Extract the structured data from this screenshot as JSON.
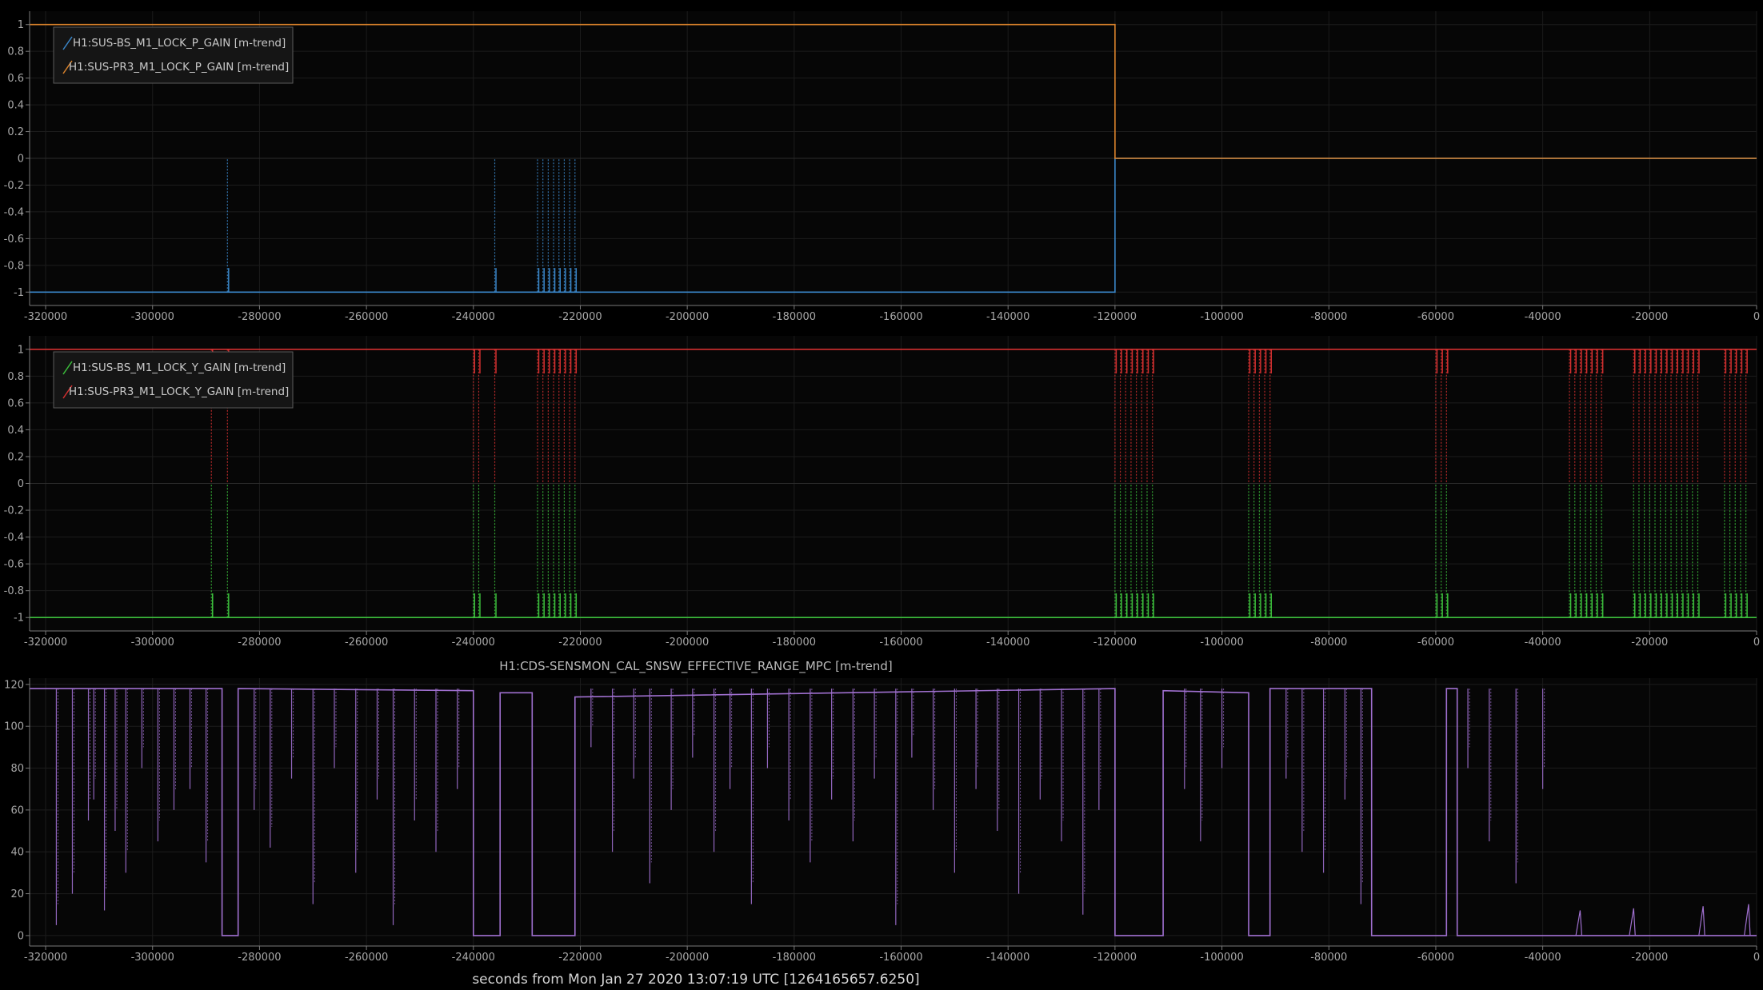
{
  "chart_data": [
    {
      "type": "line",
      "legend_position": "top-left",
      "grid": true,
      "xlim": [
        -323000,
        0
      ],
      "ylim": [
        -1.1,
        1.1
      ],
      "xticks": [
        -320000,
        -300000,
        -280000,
        -260000,
        -240000,
        -220000,
        -200000,
        -180000,
        -160000,
        -140000,
        -120000,
        -100000,
        -80000,
        -60000,
        -40000,
        -20000,
        0
      ],
      "xtick_labels": [
        "-320000",
        "-300000",
        "-280000",
        "-260000",
        "-240000",
        "-220000",
        "-200000",
        "-180000",
        "-160000",
        "-140000",
        "-120000",
        "-100000",
        "-80000",
        "-60000",
        "-40000",
        "-20000",
        "0"
      ],
      "yticks": [
        1,
        0.8,
        0.6,
        0.4,
        0.2,
        0,
        -0.2,
        -0.4,
        -0.6,
        -0.8,
        -1
      ],
      "ytick_labels": [
        "1",
        "0.8",
        "0.6",
        "0.4",
        "0.2",
        "0",
        "-0.2",
        "-0.4",
        "-0.6",
        "-0.8",
        "-1"
      ],
      "series": [
        {
          "name": "H1:SUS-BS_M1_LOCK_P_GAIN [m-trend]",
          "color": "#3a86c8",
          "x": [
            -323000,
            -120000,
            -120000,
            0
          ],
          "y": [
            -1,
            -1,
            0,
            0
          ],
          "spikes": {
            "x": [
              -286000,
              -236000,
              -228000,
              -227000,
              -226000,
              -225000,
              -224000,
              -223000,
              -222000,
              -221000
            ],
            "from": -1,
            "to": 0
          }
        },
        {
          "name": "H1:SUS-PR3_M1_LOCK_P_GAIN [m-trend]",
          "color": "#d9822b",
          "x": [
            -323000,
            -120000,
            -120000,
            0
          ],
          "y": [
            1,
            1,
            0,
            0
          ]
        }
      ]
    },
    {
      "type": "line",
      "legend_position": "top-left",
      "grid": true,
      "xlim": [
        -323000,
        0
      ],
      "ylim": [
        -1.1,
        1.1
      ],
      "xticks": [
        -320000,
        -300000,
        -280000,
        -260000,
        -240000,
        -220000,
        -200000,
        -180000,
        -160000,
        -140000,
        -120000,
        -100000,
        -80000,
        -60000,
        -40000,
        -20000,
        0
      ],
      "xtick_labels": [
        "-320000",
        "-300000",
        "-280000",
        "-260000",
        "-240000",
        "-220000",
        "-200000",
        "-180000",
        "-160000",
        "-140000",
        "-120000",
        "-100000",
        "-80000",
        "-60000",
        "-40000",
        "-20000",
        "0"
      ],
      "yticks": [
        1,
        0.8,
        0.6,
        0.4,
        0.2,
        0,
        -0.2,
        -0.4,
        -0.6,
        -0.8,
        -1
      ],
      "ytick_labels": [
        "1",
        "0.8",
        "0.6",
        "0.4",
        "0.2",
        "0",
        "-0.2",
        "-0.4",
        "-0.6",
        "-0.8",
        "-1"
      ],
      "series": [
        {
          "name": "H1:SUS-BS_M1_LOCK_Y_GAIN [m-trend]",
          "color": "#3cbf3c",
          "x": [
            -323000,
            0
          ],
          "y": [
            -1,
            -1
          ],
          "spikes": {
            "x": [
              -289000,
              -286000,
              -240000,
              -239000,
              -236000,
              -228000,
              -227000,
              -226000,
              -225000,
              -224000,
              -223000,
              -222000,
              -221000,
              -120000,
              -119000,
              -118000,
              -117000,
              -116000,
              -115000,
              -114000,
              -113000,
              -95000,
              -94000,
              -93000,
              -92000,
              -91000,
              -60000,
              -59000,
              -58000,
              -35000,
              -34000,
              -33000,
              -32000,
              -31000,
              -30000,
              -29000,
              -23000,
              -22000,
              -21000,
              -20000,
              -19000,
              -18000,
              -17000,
              -16000,
              -15000,
              -14000,
              -13000,
              -12000,
              -11000,
              -6000,
              -5000,
              -4000,
              -3000,
              -2000
            ],
            "from": -1,
            "to": 0
          }
        },
        {
          "name": "H1:SUS-PR3_M1_LOCK_Y_GAIN [m-trend]",
          "color": "#d43030",
          "x": [
            -323000,
            0
          ],
          "y": [
            1,
            1
          ],
          "spikes": {
            "x": [
              -289000,
              -286000,
              -240000,
              -239000,
              -236000,
              -228000,
              -227000,
              -226000,
              -225000,
              -224000,
              -223000,
              -222000,
              -221000,
              -120000,
              -119000,
              -118000,
              -117000,
              -116000,
              -115000,
              -114000,
              -113000,
              -95000,
              -94000,
              -93000,
              -92000,
              -91000,
              -60000,
              -59000,
              -58000,
              -35000,
              -34000,
              -33000,
              -32000,
              -31000,
              -30000,
              -29000,
              -23000,
              -22000,
              -21000,
              -20000,
              -19000,
              -18000,
              -17000,
              -16000,
              -15000,
              -14000,
              -13000,
              -12000,
              -11000,
              -6000,
              -5000,
              -4000,
              -3000,
              -2000
            ],
            "from": 1,
            "to": 0
          }
        }
      ]
    },
    {
      "type": "line",
      "title": "H1:CDS-SENSMON_CAL_SNSW_EFFECTIVE_RANGE_MPC [m-trend]",
      "xlabel": "seconds from Mon Jan 27 2020 13:07:19 UTC [1264165657.6250]",
      "grid": true,
      "xlim": [
        -323000,
        0
      ],
      "ylim": [
        -5,
        123
      ],
      "xticks": [
        -320000,
        -300000,
        -280000,
        -260000,
        -240000,
        -220000,
        -200000,
        -180000,
        -160000,
        -140000,
        -120000,
        -100000,
        -80000,
        -60000,
        -40000,
        -20000,
        0
      ],
      "xtick_labels": [
        "-320000",
        "-300000",
        "-280000",
        "-260000",
        "-240000",
        "-220000",
        "-200000",
        "-180000",
        "-160000",
        "-140000",
        "-120000",
        "-100000",
        "-80000",
        "-60000",
        "-40000",
        "-20000",
        "0"
      ],
      "yticks": [
        120,
        100,
        80,
        60,
        40,
        20,
        0
      ],
      "ytick_labels": [
        "120",
        "100",
        "80",
        "60",
        "40",
        "20",
        "0"
      ],
      "series": [
        {
          "color": "#a070d0",
          "x": [
            -323000,
            -287000,
            -287000,
            -284000,
            -284000,
            -240000,
            -240000,
            -235000,
            -235000,
            -229000,
            -229000,
            -221000,
            -221000,
            -120000,
            -120000,
            -111000,
            -111000,
            -95000,
            -95000,
            -91000,
            -91000,
            -72000,
            -72000,
            -58000,
            -58000,
            -56000,
            -56000,
            -35000,
            -35000,
            0
          ],
          "y": [
            118,
            118,
            0,
            0,
            118,
            117,
            0,
            0,
            116,
            116,
            0,
            0,
            114,
            118,
            0,
            0,
            117,
            116,
            0,
            0,
            118,
            118,
            0,
            0,
            118,
            118,
            0,
            0,
            0,
            0
          ],
          "dips": [
            {
              "x": -318000,
              "y": 5
            },
            {
              "x": -315000,
              "y": 20
            },
            {
              "x": -312000,
              "y": 55
            },
            {
              "x": -311000,
              "y": 65
            },
            {
              "x": -309000,
              "y": 12
            },
            {
              "x": -307000,
              "y": 50
            },
            {
              "x": -305000,
              "y": 30
            },
            {
              "x": -302000,
              "y": 80
            },
            {
              "x": -299000,
              "y": 45
            },
            {
              "x": -296000,
              "y": 60
            },
            {
              "x": -293000,
              "y": 70
            },
            {
              "x": -290000,
              "y": 35
            },
            {
              "x": -281000,
              "y": 60
            },
            {
              "x": -278000,
              "y": 42
            },
            {
              "x": -274000,
              "y": 75
            },
            {
              "x": -270000,
              "y": 15
            },
            {
              "x": -266000,
              "y": 80
            },
            {
              "x": -262000,
              "y": 30
            },
            {
              "x": -258000,
              "y": 65
            },
            {
              "x": -255000,
              "y": 5
            },
            {
              "x": -251000,
              "y": 55
            },
            {
              "x": -247000,
              "y": 40
            },
            {
              "x": -243000,
              "y": 70
            },
            {
              "x": -218000,
              "y": 90
            },
            {
              "x": -214000,
              "y": 40
            },
            {
              "x": -210000,
              "y": 75
            },
            {
              "x": -207000,
              "y": 25
            },
            {
              "x": -203000,
              "y": 60
            },
            {
              "x": -199000,
              "y": 85
            },
            {
              "x": -195000,
              "y": 40
            },
            {
              "x": -192000,
              "y": 70
            },
            {
              "x": -188000,
              "y": 15
            },
            {
              "x": -185000,
              "y": 80
            },
            {
              "x": -181000,
              "y": 55
            },
            {
              "x": -177000,
              "y": 35
            },
            {
              "x": -173000,
              "y": 65
            },
            {
              "x": -169000,
              "y": 45
            },
            {
              "x": -165000,
              "y": 75
            },
            {
              "x": -161000,
              "y": 5
            },
            {
              "x": -158000,
              "y": 85
            },
            {
              "x": -154000,
              "y": 60
            },
            {
              "x": -150000,
              "y": 30
            },
            {
              "x": -146000,
              "y": 70
            },
            {
              "x": -142000,
              "y": 50
            },
            {
              "x": -138000,
              "y": 20
            },
            {
              "x": -134000,
              "y": 65
            },
            {
              "x": -130000,
              "y": 45
            },
            {
              "x": -126000,
              "y": 10
            },
            {
              "x": -123000,
              "y": 60
            },
            {
              "x": -107000,
              "y": 70
            },
            {
              "x": -104000,
              "y": 45
            },
            {
              "x": -100000,
              "y": 80
            },
            {
              "x": -88000,
              "y": 75
            },
            {
              "x": -85000,
              "y": 40
            },
            {
              "x": -81000,
              "y": 30
            },
            {
              "x": -77000,
              "y": 65
            },
            {
              "x": -74000,
              "y": 15
            },
            {
              "x": -54000,
              "y": 80
            },
            {
              "x": -50000,
              "y": 45
            },
            {
              "x": -45000,
              "y": 25
            },
            {
              "x": -40000,
              "y": 70
            }
          ],
          "bumps": [
            {
              "x": -33000,
              "y": 12
            },
            {
              "x": -23000,
              "y": 13
            },
            {
              "x": -10000,
              "y": 14
            },
            {
              "x": -1500,
              "y": 15
            }
          ]
        }
      ]
    }
  ]
}
